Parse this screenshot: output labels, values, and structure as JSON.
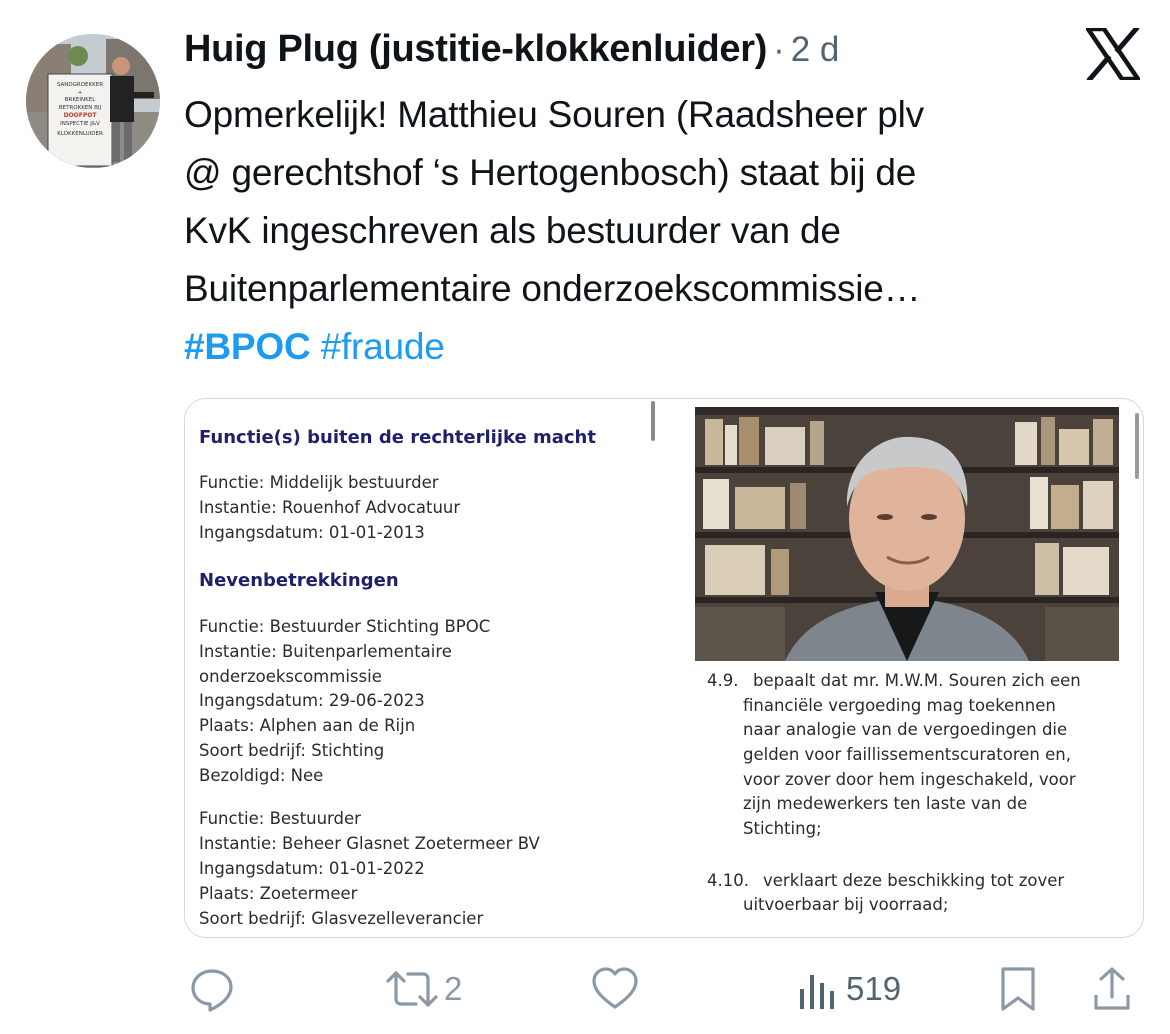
{
  "tweet": {
    "author": "Huig Plug (justitie-klokkenluider)",
    "separator": "·",
    "time": "2 d",
    "lines": [
      "Opmerkelijk! Matthieu Souren (Raadsheer plv",
      "@ gerechtshof ‘s Hertogenbosch) staat bij de",
      "KvK ingeschreven als bestuurder van de",
      "Buitenparlementaire onderzoekscommissie…"
    ],
    "hashtags": [
      "#BPOC",
      "#fraude"
    ]
  },
  "avatar_sign_text": [
    "SANDGROEKKER",
    "+",
    "BRKEINKEL",
    "BETROKKEN BIJ",
    "DOOFPOT",
    "INSPECTIE J&V",
    "KLOKKENLUIDER"
  ],
  "media": {
    "left_doc": {
      "heading1": "Functie(s) buiten de rechterlijke macht",
      "block1": [
        "Functie: Middelijk bestuurder",
        "Instantie: Rouenhof Advocatuur",
        "Ingangsdatum: 01-01-2013"
      ],
      "heading2": "Nevenbetrekkingen",
      "block2": [
        "Functie: Bestuurder Stichting BPOC",
        "Instantie: Buitenparlementaire",
        "onderzoekscommissie",
        "Ingangsdatum: 29-06-2023",
        "Plaats: Alphen aan de Rijn",
        "Soort bedrijf: Stichting",
        "Bezoldigd: Nee"
      ],
      "block3": [
        "Functie: Bestuurder",
        "Instantie: Beheer Glasnet Zoetermeer BV",
        "Ingangsdatum: 01-01-2022",
        "Plaats: Zoetermeer",
        "Soort bedrijf: Glasvezelleverancier"
      ]
    },
    "right_doc": {
      "item1_num": "4.9.",
      "item1_lines": [
        "bepaalt dat mr. M.W.M. Souren zich een",
        "financiële vergoeding mag toekennen",
        "naar analogie van de vergoedingen die",
        "gelden voor faillissementscuratoren en,",
        "voor zover door hem ingeschakeld, voor",
        "zijn medewerkers ten laste van de",
        "Stichting;"
      ],
      "item2_num": "4.10.",
      "item2_lines": [
        "verklaart deze beschikking tot zover",
        "uitvoerbaar bij voorraad;"
      ]
    }
  },
  "actions": {
    "reply_count": "",
    "retweet_count": "2",
    "like_count": "",
    "view_count": "519"
  },
  "colors": {
    "link": "#1d9bf0",
    "text": "#0f1419",
    "muted": "#536471",
    "icon": "#8b98a5",
    "doc_heading": "#1f1f6b"
  }
}
